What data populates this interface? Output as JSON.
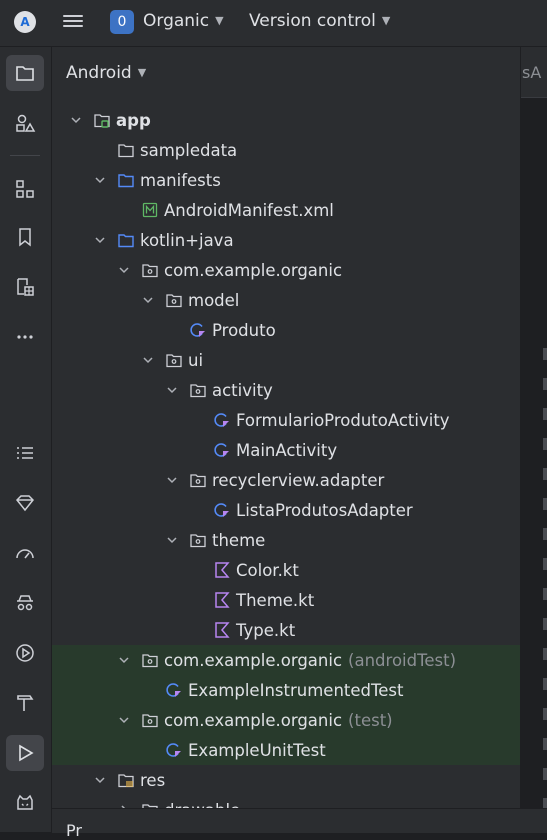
{
  "titlebar": {
    "logo": "A",
    "project_badge": "0",
    "project_name": "Organic",
    "vcs_label": "Version control"
  },
  "toolstrip": {
    "top": [
      "folder-icon",
      "shapes-icon",
      "structure-icon",
      "bookmark-icon",
      "resource-manager-icon",
      "more-icon"
    ],
    "bottom": [
      "list-icon",
      "gem-icon",
      "gauge-icon",
      "spy-icon",
      "run-circle-icon",
      "hammer-icon",
      "run-icon",
      "cat-icon"
    ]
  },
  "panel": {
    "view_mode": "Android",
    "bottom_label": "Pr"
  },
  "editor": {
    "tab_partial": "sA"
  },
  "colors": {
    "folder": "#548af7",
    "package": "#ced0d6",
    "kotlin": "#b785f0",
    "manifest": "#5fb865",
    "test_row_bg": "#283a2c"
  },
  "tree": [
    {
      "label": "app",
      "icon": "module",
      "depth": 0,
      "arrow": "down",
      "bold": true
    },
    {
      "label": "sampledata",
      "icon": "folder-plain",
      "depth": 1,
      "arrow": "none"
    },
    {
      "label": "manifests",
      "icon": "folder-blue",
      "depth": 1,
      "arrow": "down"
    },
    {
      "label": "AndroidManifest.xml",
      "icon": "manifest",
      "depth": 2,
      "arrow": "none"
    },
    {
      "label": "kotlin+java",
      "icon": "folder-blue",
      "depth": 1,
      "arrow": "down"
    },
    {
      "label": "com.example.organic",
      "icon": "package",
      "depth": 2,
      "arrow": "down"
    },
    {
      "label": "model",
      "icon": "package",
      "depth": 3,
      "arrow": "down"
    },
    {
      "label": "Produto",
      "icon": "kotlin-class",
      "depth": 4,
      "arrow": "none"
    },
    {
      "label": "ui",
      "icon": "package",
      "depth": 3,
      "arrow": "down"
    },
    {
      "label": "activity",
      "icon": "package",
      "depth": 4,
      "arrow": "down"
    },
    {
      "label": "FormularioProdutoActivity",
      "icon": "kotlin-class",
      "depth": 5,
      "arrow": "none"
    },
    {
      "label": "MainActivity",
      "icon": "kotlin-class",
      "depth": 5,
      "arrow": "none"
    },
    {
      "label": "recyclerview.adapter",
      "icon": "package",
      "depth": 4,
      "arrow": "down"
    },
    {
      "label": "ListaProdutosAdapter",
      "icon": "kotlin-class",
      "depth": 5,
      "arrow": "none"
    },
    {
      "label": "theme",
      "icon": "package",
      "depth": 4,
      "arrow": "down"
    },
    {
      "label": "Color.kt",
      "icon": "kotlin-file",
      "depth": 5,
      "arrow": "none"
    },
    {
      "label": "Theme.kt",
      "icon": "kotlin-file",
      "depth": 5,
      "arrow": "none"
    },
    {
      "label": "Type.kt",
      "icon": "kotlin-file",
      "depth": 5,
      "arrow": "none"
    },
    {
      "label": "com.example.organic",
      "suffix": "(androidTest)",
      "icon": "package",
      "depth": 2,
      "arrow": "down",
      "green": true
    },
    {
      "label": "ExampleInstrumentedTest",
      "icon": "kotlin-class",
      "depth": 3,
      "arrow": "none",
      "green": true
    },
    {
      "label": "com.example.organic",
      "suffix": "(test)",
      "icon": "package",
      "depth": 2,
      "arrow": "down",
      "green": true
    },
    {
      "label": "ExampleUnitTest",
      "icon": "kotlin-class",
      "depth": 3,
      "arrow": "none",
      "green": true
    },
    {
      "label": "res",
      "icon": "folder-res",
      "depth": 1,
      "arrow": "down"
    },
    {
      "label": "drawable",
      "icon": "folder-plain",
      "depth": 2,
      "arrow": "right"
    }
  ]
}
